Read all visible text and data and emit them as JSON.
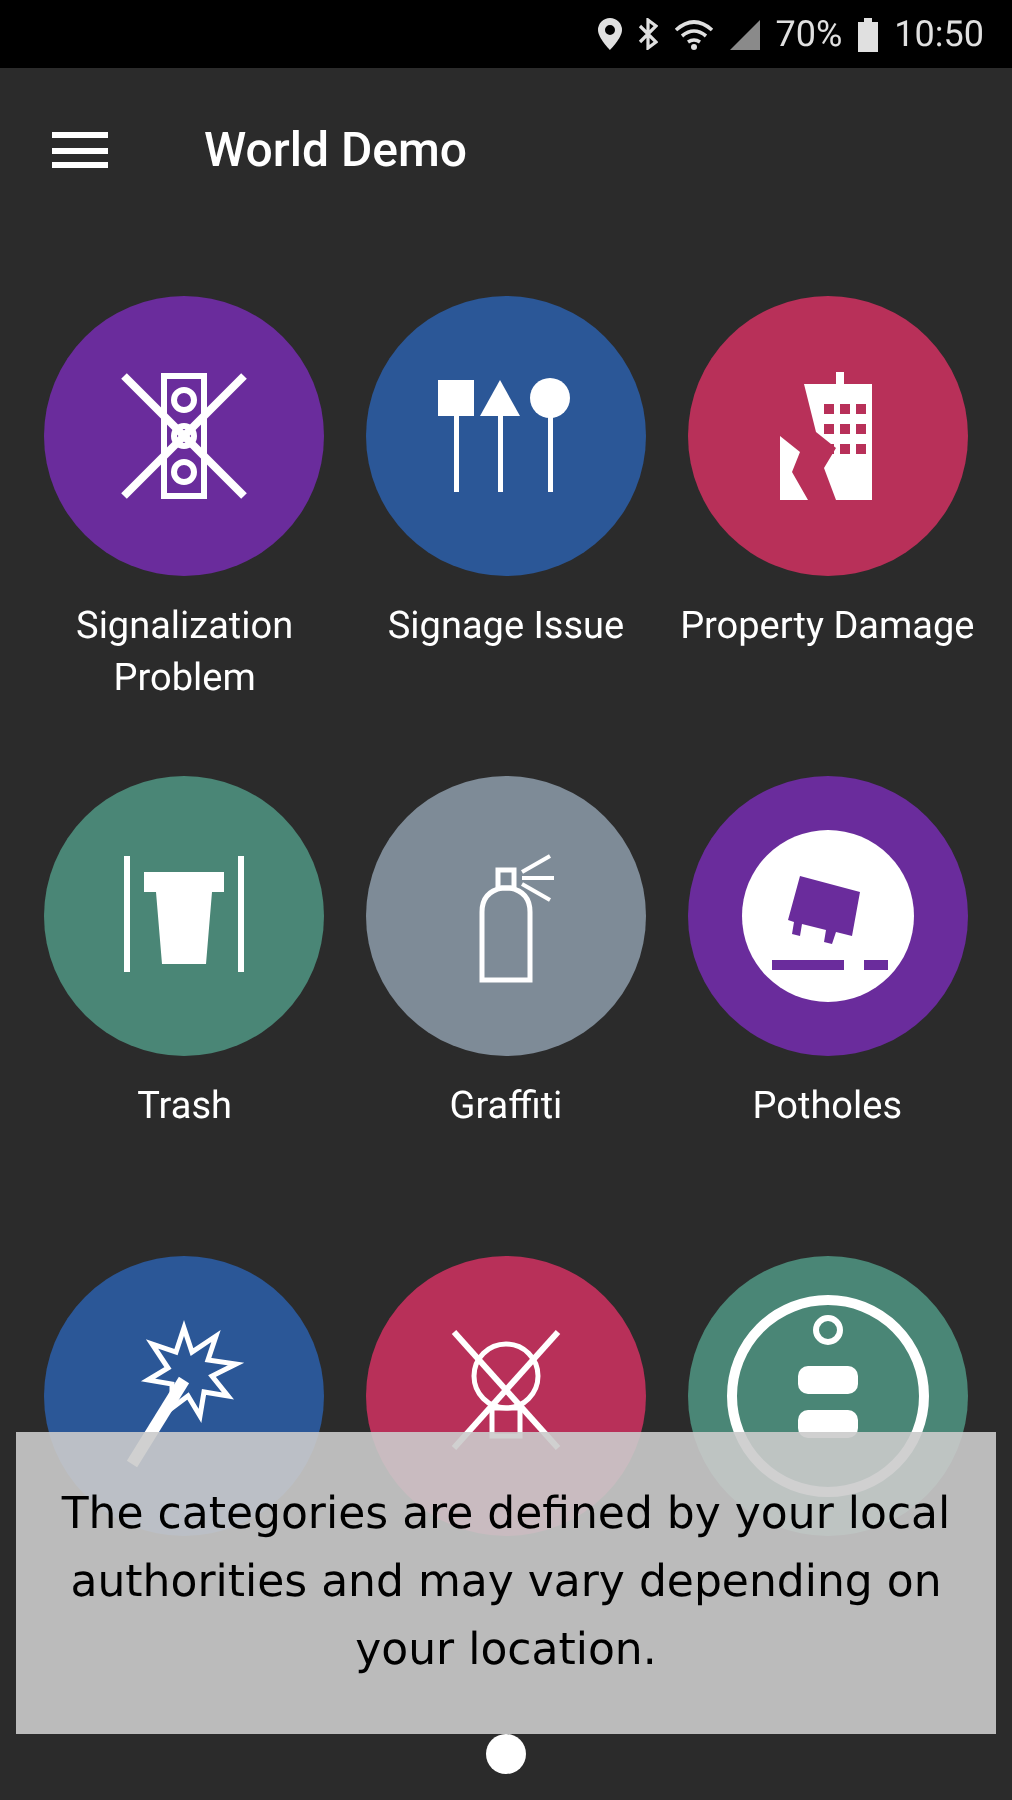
{
  "status_bar": {
    "battery": "70%",
    "time": "10:50"
  },
  "app_bar": {
    "title": "World Demo"
  },
  "categories": [
    {
      "label": "Signalization Problem",
      "color": "#6a2c9c"
    },
    {
      "label": "Signage Issue",
      "color": "#2b5797"
    },
    {
      "label": "Property Damage",
      "color": "#b83059"
    },
    {
      "label": "Trash",
      "color": "#4a8676"
    },
    {
      "label": "Graffiti",
      "color": "#7e8b97"
    },
    {
      "label": "Potholes",
      "color": "#6a2c9c"
    },
    {
      "color": "#2b5797"
    },
    {
      "color": "#b83059"
    },
    {
      "color": "#4a8676"
    }
  ],
  "overlay": {
    "text": "The categories are defined by your local authorities and may vary depending on your location."
  },
  "pager": [
    {
      "selected": true
    }
  ]
}
